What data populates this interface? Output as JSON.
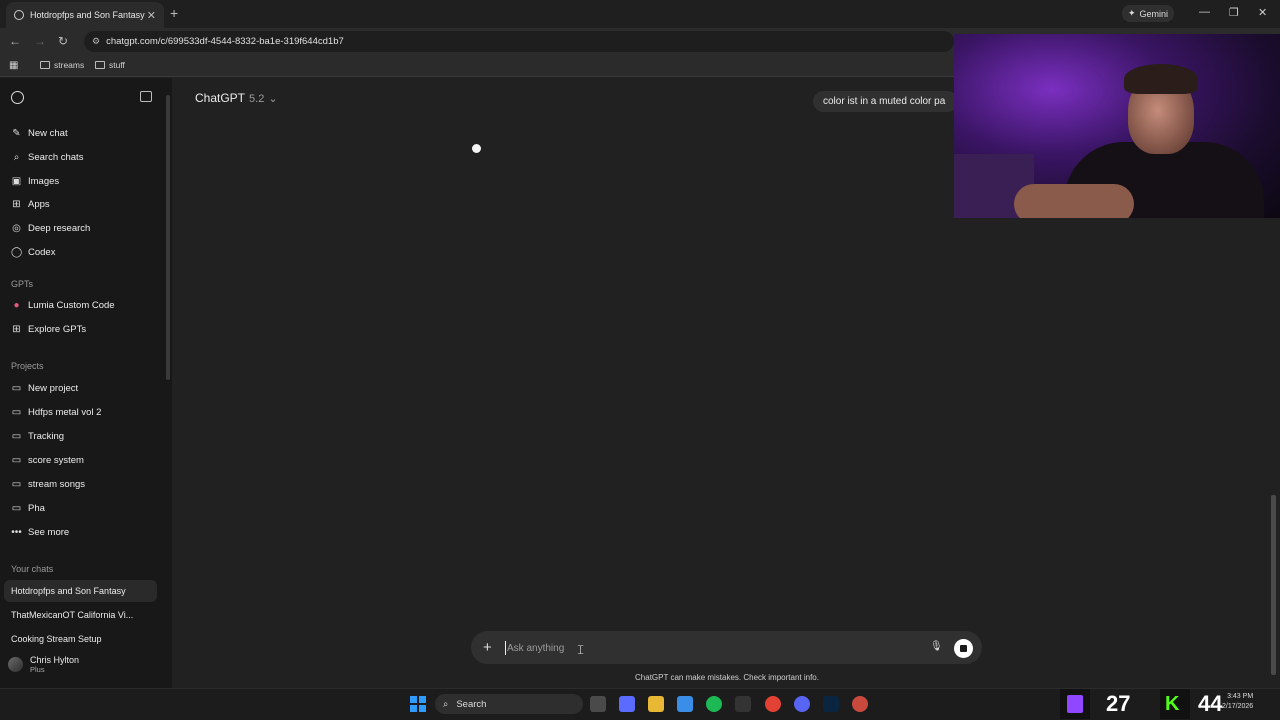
{
  "browser": {
    "tab_title": "Hotdropfps and Son Fantasy",
    "url": "chatgpt.com/c/699533df-4544-8332-ba1e-319f644cd1b7",
    "gemini_label": "Gemini",
    "bookmarks": [
      "streams",
      "stuff"
    ]
  },
  "sidebar": {
    "nav": [
      {
        "label": "New chat",
        "icon": "pencil-icon"
      },
      {
        "label": "Search chats",
        "icon": "search-icon"
      },
      {
        "label": "Images",
        "icon": "image-icon"
      },
      {
        "label": "Apps",
        "icon": "apps-icon"
      },
      {
        "label": "Deep research",
        "icon": "research-icon"
      },
      {
        "label": "Codex",
        "icon": "code-icon"
      }
    ],
    "gpts_heading": "GPTs",
    "gpts": [
      {
        "label": "Lumia Custom Code",
        "icon": "lumia-icon"
      },
      {
        "label": "Explore GPTs",
        "icon": "explore-icon"
      }
    ],
    "projects_heading": "Projects",
    "projects": [
      {
        "label": "New project",
        "icon": "folder-plus-icon"
      },
      {
        "label": "Hdfps metal vol 2",
        "icon": "folder-icon"
      },
      {
        "label": "Tracking",
        "icon": "folder-icon"
      },
      {
        "label": "score system",
        "icon": "folder-icon"
      },
      {
        "label": "stream songs",
        "icon": "folder-icon"
      },
      {
        "label": "Pha",
        "icon": "folder-icon"
      },
      {
        "label": "See more",
        "icon": "ellipsis-icon"
      }
    ],
    "chats_heading": "Your chats",
    "chats": [
      {
        "label": "Hotdropfps and Son Fantasy",
        "active": true
      },
      {
        "label": "ThatMexicanOT California Vi...",
        "active": false
      },
      {
        "label": "Cooking Stream Setup",
        "active": false
      }
    ],
    "user": {
      "name": "Chris Hylton",
      "plan": "Plus"
    }
  },
  "main": {
    "model_name": "ChatGPT",
    "model_version": "5.2",
    "user_message": "color ist in a muted color pa",
    "composer_placeholder": "Ask anything",
    "disclaimer": "ChatGPT can make mistakes. Check important info."
  },
  "overlay": {
    "twitch_count": "27",
    "kick_count": "44"
  },
  "taskbar": {
    "search_label": "Search",
    "time": "3:43 PM",
    "date": "2/17/2026"
  }
}
